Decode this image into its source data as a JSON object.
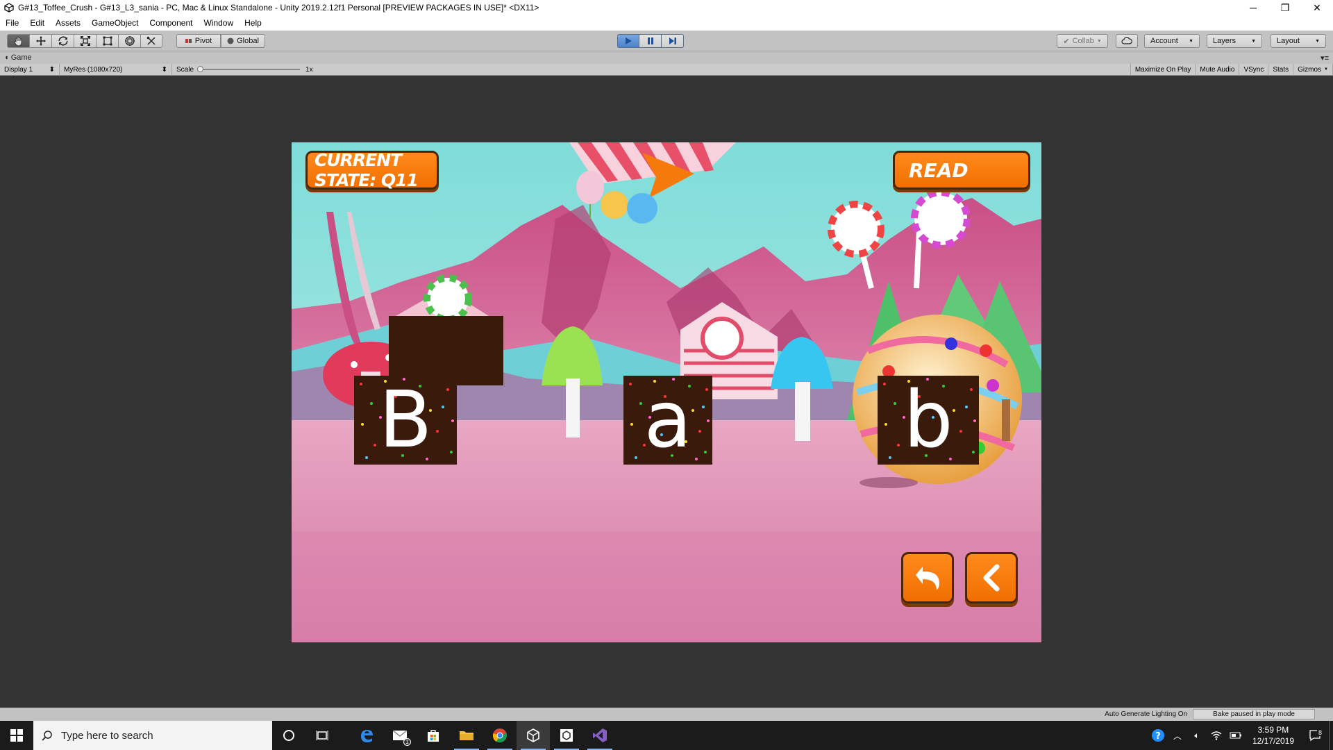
{
  "window": {
    "title": "G#13_Toffee_Crush - G#13_L3_sania - PC, Mac & Linux Standalone - Unity 2019.2.12f1 Personal [PREVIEW PACKAGES IN USE]* <DX11>",
    "minimize": "─",
    "maximize": "❐",
    "close": "✕"
  },
  "menu": [
    "File",
    "Edit",
    "Assets",
    "GameObject",
    "Component",
    "Window",
    "Help"
  ],
  "toolbar": {
    "pivot": "Pivot",
    "global": "Global",
    "collab": "Collab",
    "account": "Account",
    "layers": "Layers",
    "layout": "Layout"
  },
  "game_tab": {
    "label": "Game",
    "display": "Display 1",
    "resolution": "MyRes (1080x720)",
    "scale_label": "Scale",
    "scale_value": "1x",
    "maximize_on_play": "Maximize On Play",
    "mute_audio": "Mute Audio",
    "vsync": "VSync",
    "stats": "Stats",
    "gizmos": "Gizmos"
  },
  "game": {
    "state_label": "CURRENT STATE: Q11",
    "read_label": "READ",
    "letters": [
      "B",
      "a",
      "b"
    ]
  },
  "status": {
    "lighting": "Auto Generate Lighting On",
    "bake": "Bake paused in play mode"
  },
  "taskbar": {
    "search_placeholder": "Type here to search",
    "time": "3:59 PM",
    "date": "12/17/2019",
    "notifications": "8",
    "mail_badge": "1"
  },
  "colors": {
    "accent_orange": "#f47a0c",
    "play_blue": "#4c82cc",
    "editor_gray": "#c2c2c2",
    "viewport_dark": "#333333"
  }
}
